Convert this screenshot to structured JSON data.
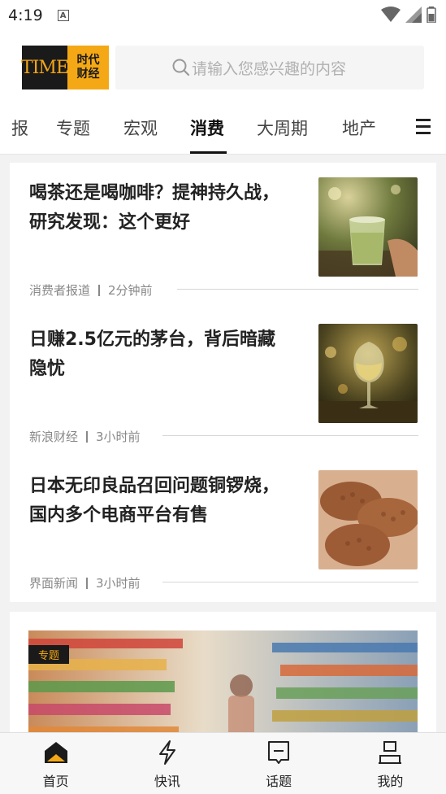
{
  "status_bar": {
    "time": "4:19",
    "notification_letter": "A"
  },
  "header": {
    "logo_left": "TIME",
    "logo_right_line1": "时代",
    "logo_right_line2": "财经",
    "search_placeholder": "请输入您感兴趣的内容"
  },
  "tabs": [
    {
      "label": "报"
    },
    {
      "label": "专题"
    },
    {
      "label": "宏观"
    },
    {
      "label": "消费",
      "active": true
    },
    {
      "label": "大周期"
    },
    {
      "label": "地产"
    }
  ],
  "articles": [
    {
      "title": "喝茶还是喝咖啡？提神持久战，研究发现：这个更好",
      "source": "消费者报道",
      "time": "2分钟前",
      "thumb": "matcha-latte-photo"
    },
    {
      "title": "日赚2.5亿元的茅台，背后暗藏隐忧",
      "source": "新浪财经",
      "time": "3小时前",
      "thumb": "wine-glass-photo"
    },
    {
      "title": "日本无印良品召回问题铜锣烧，国内多个电商平台有售",
      "source": "界面新闻",
      "time": "3小时前",
      "thumb": "taiyaki-photo"
    }
  ],
  "feature": {
    "badge": "专题",
    "image": "supermarket-aisle-photo"
  },
  "bottom_nav": [
    {
      "label": "首页",
      "icon": "home-icon",
      "active": true
    },
    {
      "label": "快讯",
      "icon": "lightning-icon"
    },
    {
      "label": "话题",
      "icon": "topic-icon"
    },
    {
      "label": "我的",
      "icon": "profile-icon"
    }
  ],
  "colors": {
    "brand_gold": "#f5a815",
    "brand_dark": "#1a1a1a",
    "text_primary": "#222222",
    "text_meta": "#888888"
  }
}
